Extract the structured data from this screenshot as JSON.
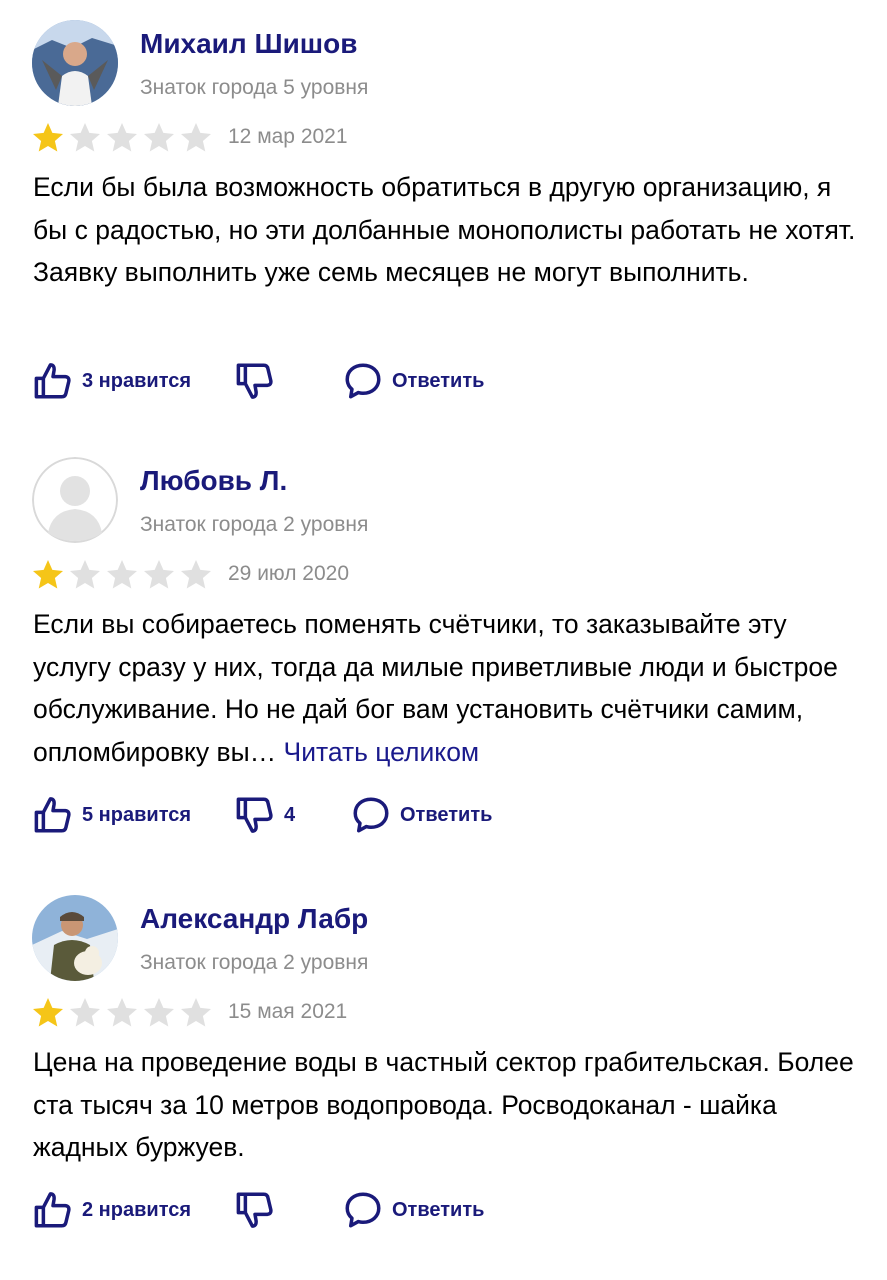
{
  "colors": {
    "accent": "#1a1a7a",
    "star_filled": "#f5c518",
    "star_empty": "#e0e0e0",
    "meta": "#8c8c8c"
  },
  "reviews": [
    {
      "author": "Михаил Шишов",
      "level": "Знаток города 5 уровня",
      "rating": 1,
      "rating_max": 5,
      "date": "12 мар 2021",
      "text": "Если бы была возможность обратиться в другую организацию, я бы с радостью, но эти долбанные монополисты работать не хотят. Заявку выполнить уже семь месяцев не могут выполнить.",
      "read_more": "",
      "like_label": "3 нравится",
      "dislike_count": "",
      "reply_label": "Ответить",
      "avatar_icon": "user-photo-icon"
    },
    {
      "author": "Любовь Л.",
      "level": "Знаток города 2 уровня",
      "rating": 1,
      "rating_max": 5,
      "date": "29 июл 2020",
      "text": "Если вы собираетесь поменять счётчики, то заказывайте эту услугу сразу у них, тогда да милые приветливые люди и быстрое обслуживание. Но не дай бог вам установить счётчики самим, опломбировку вы…",
      "read_more": " Читать целиком",
      "like_label": "5 нравится",
      "dislike_count": "4",
      "reply_label": "Ответить",
      "avatar_icon": "default-user-icon"
    },
    {
      "author": "Александр Лабр",
      "level": "Знаток города 2 уровня",
      "rating": 1,
      "rating_max": 5,
      "date": "15 мая 2021",
      "text": "Цена на проведение воды в частный сектор грабительская. Более ста тысяч за 10 метров водопровода. Росводоканал - шайка жадных буржуев.",
      "read_more": "",
      "like_label": "2 нравится",
      "dislike_count": "",
      "reply_label": "Ответить",
      "avatar_icon": "user-photo-icon"
    }
  ]
}
